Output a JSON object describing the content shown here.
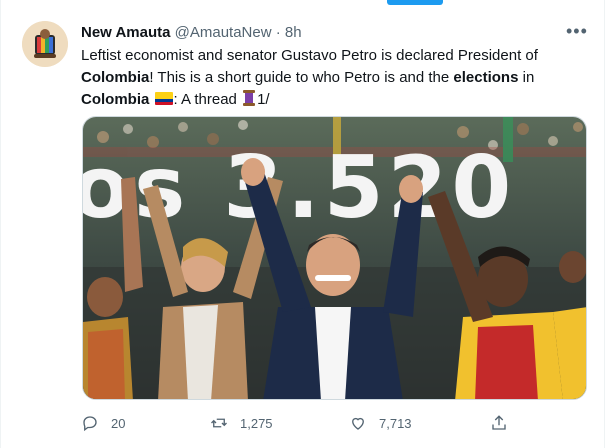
{
  "tweet": {
    "display_name": "New Amauta",
    "handle": "@AmautaNew",
    "separator": "·",
    "time": "8h",
    "text_part1": "Leftist economist and senator Gustavo Petro is declared President of ",
    "text_bold1": "Colombia",
    "text_part2": "! This is a short guide to who Petro is and the ",
    "text_bold2": "elections",
    "text_part3": " in ",
    "text_bold3": "Colombia",
    "text_part4": ": A thread ",
    "text_part5": "1/",
    "media_overlay_text": "os 3.520"
  },
  "actions": {
    "replies": "20",
    "retweets": "1,275",
    "likes": "7,713"
  },
  "icons": {
    "more": "more-dots-icon",
    "reply": "reply-icon",
    "retweet": "retweet-icon",
    "like": "heart-icon",
    "share": "share-icon",
    "flag": "colombia-flag-emoji",
    "spool": "thread-spool-emoji"
  },
  "colors": {
    "accent": "#1d9bf0",
    "secondary_text": "#536471"
  }
}
